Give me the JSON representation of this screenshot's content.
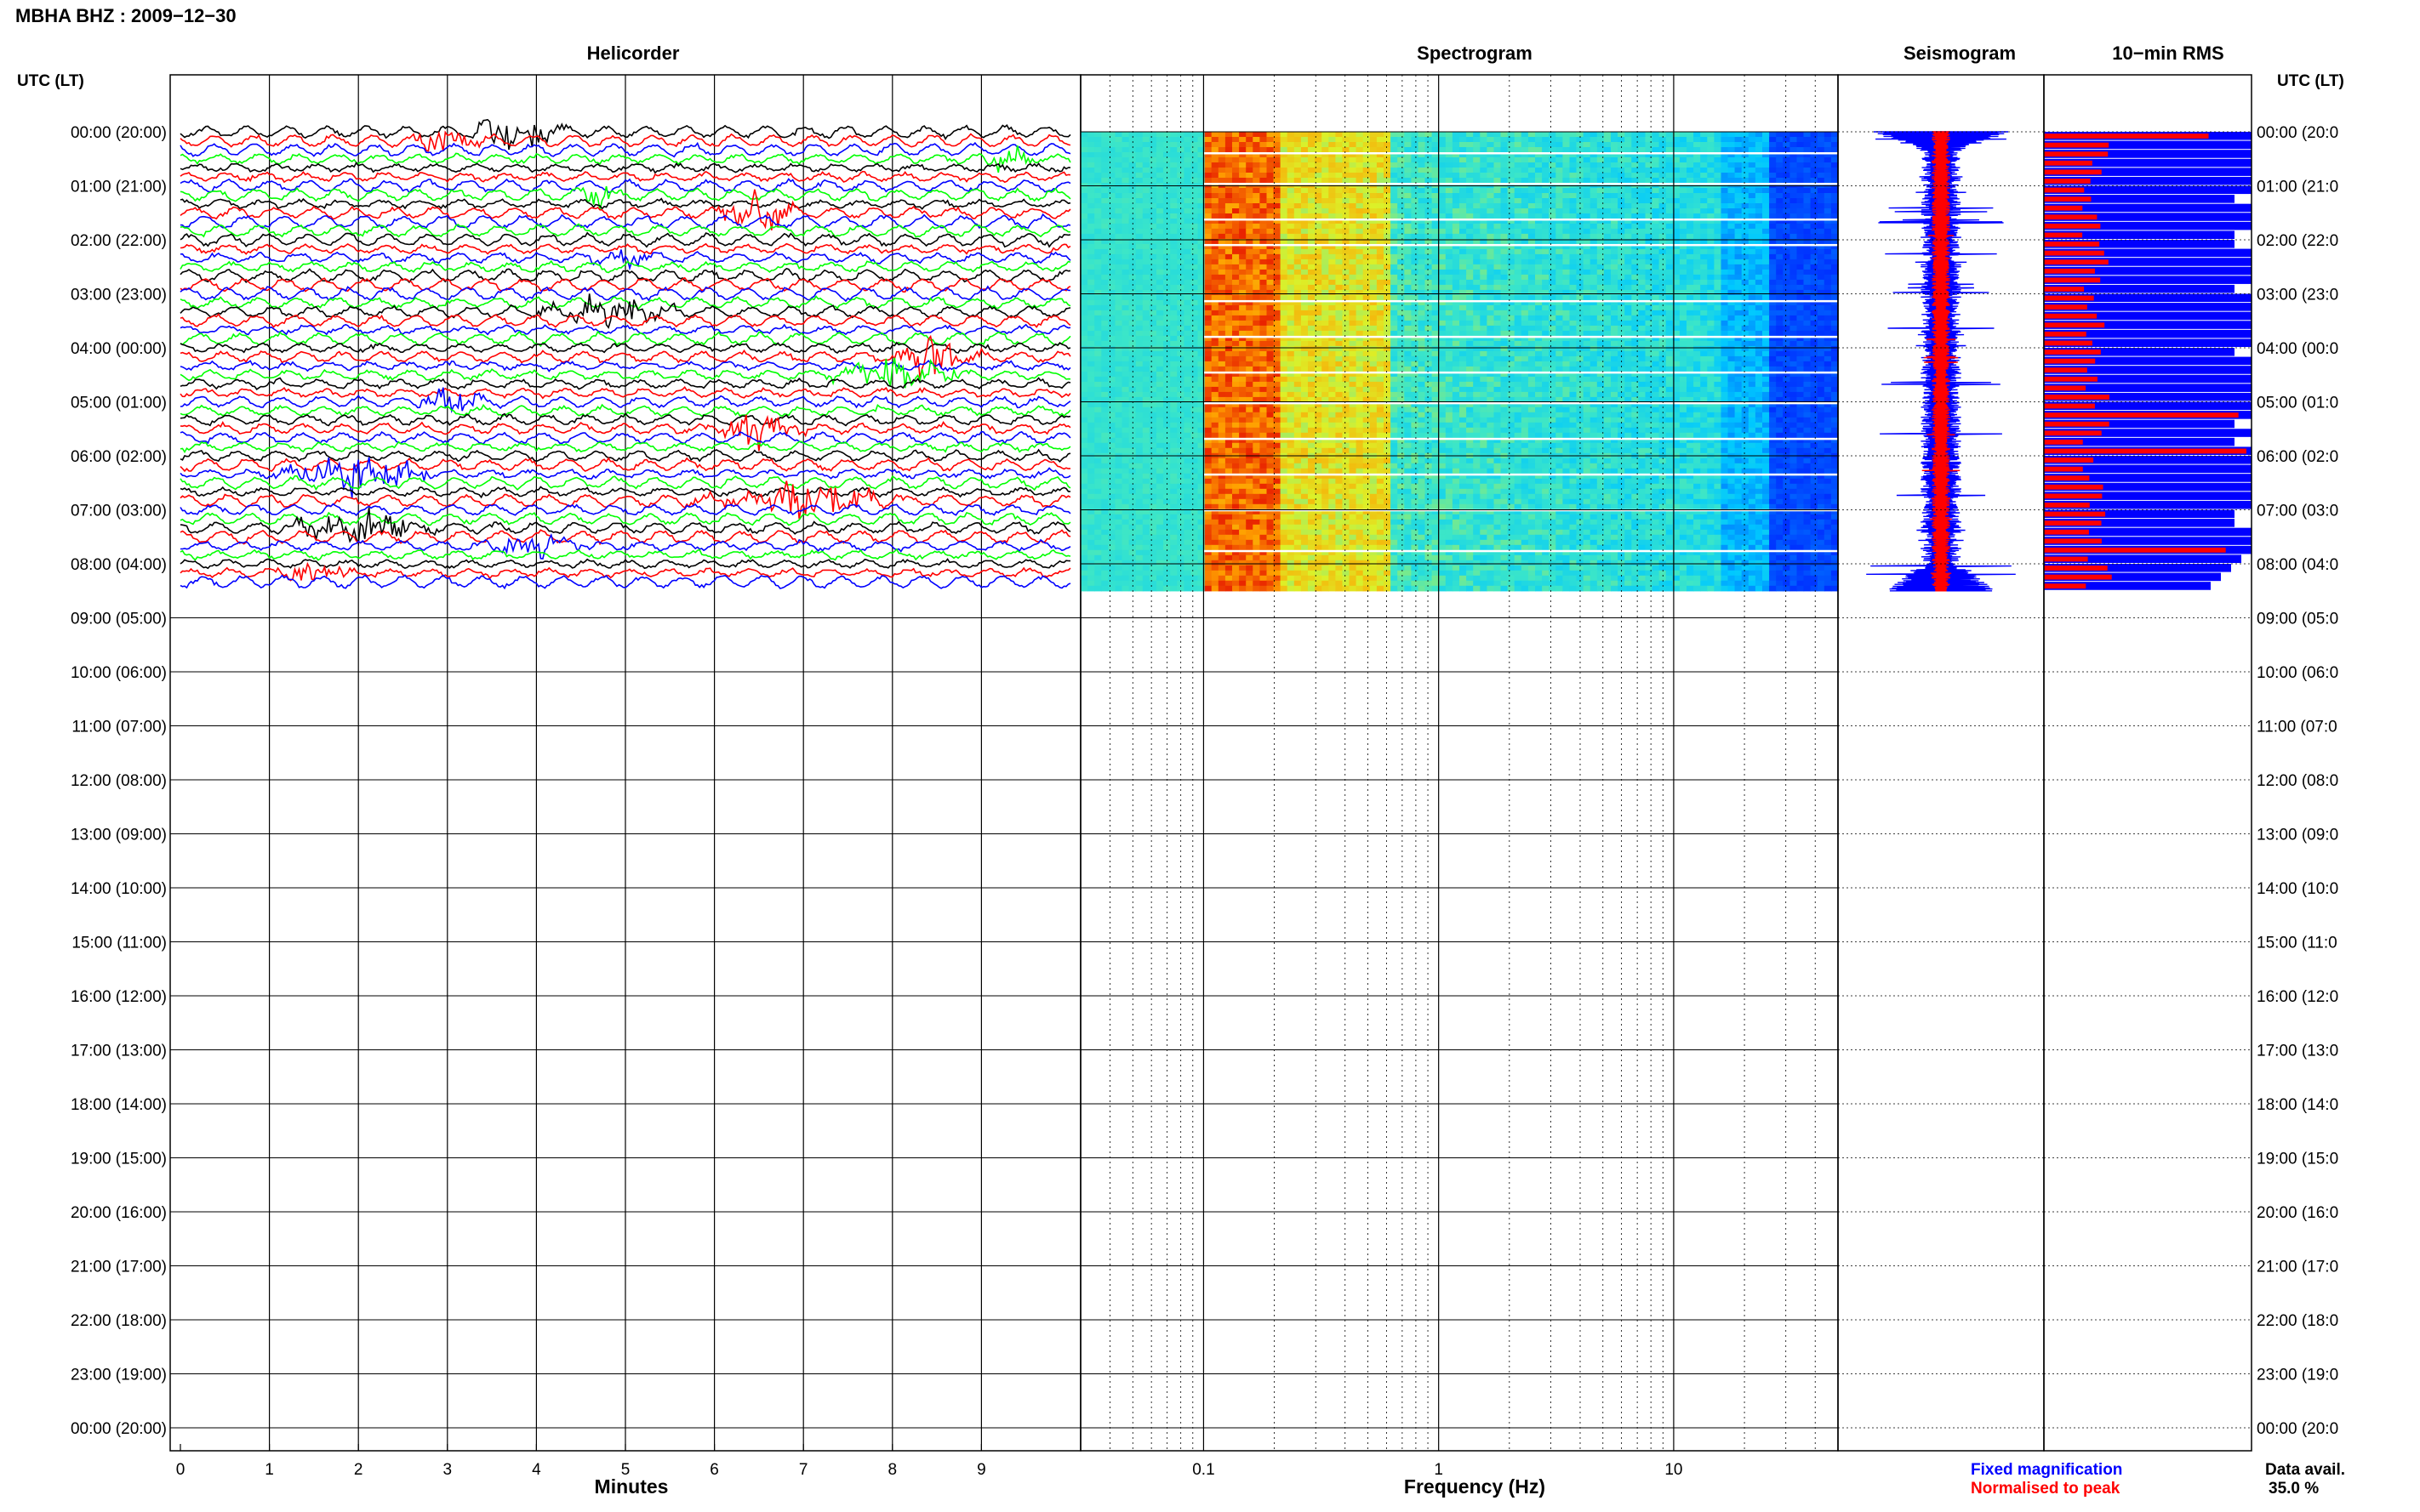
{
  "title": "MBHA BHZ : 2009−12−30",
  "colors": {
    "trace": [
      "#000000",
      "#ff0000",
      "#0000ff",
      "#00ff00"
    ],
    "fixed": "#0000ff",
    "normalised": "#ff0000"
  },
  "panels": {
    "helicorder": "Helicorder",
    "spectrogram": "Spectrogram",
    "seismogram": "Seismogram",
    "rms": "10−min RMS"
  },
  "y_axis_label": "UTC (LT)",
  "hour_labels": [
    "00:00 (20:00)",
    "01:00 (21:00)",
    "02:00 (22:00)",
    "03:00 (23:00)",
    "04:00 (00:00)",
    "05:00 (01:00)",
    "06:00 (02:00)",
    "07:00 (03:00)",
    "08:00 (04:00)",
    "09:00 (05:00)",
    "10:00 (06:00)",
    "11:00 (07:00)",
    "12:00 (08:00)",
    "13:00 (09:00)",
    "14:00 (10:00)",
    "15:00 (11:00)",
    "16:00 (12:00)",
    "17:00 (13:00)",
    "18:00 (14:00)",
    "19:00 (15:00)",
    "20:00 (16:00)",
    "21:00 (17:00)",
    "22:00 (18:00)",
    "23:00 (19:00)",
    "00:00 (20:00)"
  ],
  "right_hour_labels": [
    "00:00 (20:0",
    "01:00 (21:0",
    "02:00 (22:0",
    "03:00 (23:0",
    "04:00 (00:0",
    "05:00 (01:0",
    "06:00 (02:0",
    "07:00 (03:0",
    "08:00 (04:0",
    "09:00 (05:0",
    "10:00 (06:0",
    "11:00 (07:0",
    "12:00 (08:0",
    "13:00 (09:0",
    "14:00 (10:0",
    "15:00 (11:0",
    "16:00 (12:0",
    "17:00 (13:0",
    "18:00 (14:0",
    "19:00 (15:0",
    "20:00 (16:0",
    "21:00 (17:0",
    "22:00 (18:0",
    "23:00 (19:0",
    "00:00 (20:0"
  ],
  "chart_data": [
    {
      "type": "line",
      "panel": "Helicorder",
      "xlabel": "Minutes",
      "x_ticks": [
        "0",
        "1",
        "2",
        "3",
        "4",
        "5",
        "6",
        "7",
        "8",
        "9"
      ],
      "xlim": [
        0,
        10
      ],
      "rows_per_hour": 6,
      "rows_with_data": 51,
      "series_colors_cycle": [
        "black",
        "red",
        "blue",
        "green"
      ]
    },
    {
      "type": "heatmap",
      "panel": "Spectrogram",
      "xlabel": "Frequency (Hz)",
      "x_scale": "log",
      "x_ticks": [
        "0.1",
        "1",
        "10"
      ],
      "xlim": [
        0.03,
        50
      ],
      "hours_with_data": [
        0,
        8.5
      ]
    },
    {
      "type": "line",
      "panel": "Seismogram",
      "series": [
        {
          "name": "Fixed magnification",
          "color": "#0000ff"
        },
        {
          "name": "Normalised to peak",
          "color": "#ff0000"
        }
      ]
    },
    {
      "type": "bar",
      "panel": "10−min RMS",
      "orientation": "horizontal",
      "series": [
        {
          "name": "Fixed magnification",
          "color": "#0000ff"
        },
        {
          "name": "Normalised to peak",
          "color": "#ff0000"
        }
      ]
    }
  ],
  "legend": {
    "fixed": "Fixed magnification",
    "normalised": "Normalised to peak"
  },
  "data_avail": {
    "label": "Data avail.",
    "value": "35.0 %"
  }
}
